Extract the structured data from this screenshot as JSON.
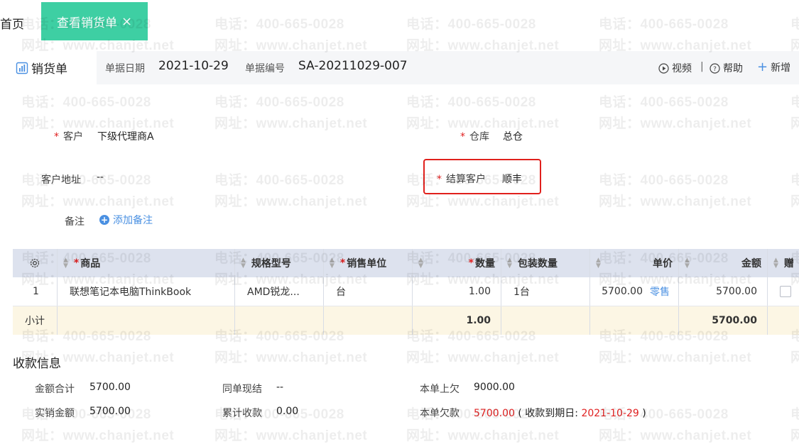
{
  "tabs": {
    "home": "首页",
    "active": "查看销货单",
    "close": "×"
  },
  "watermark": {
    "phone": "电话：400-665-0028",
    "site": "网址：www.chanjet.net"
  },
  "header": {
    "doc_type": "销货单",
    "date_label": "单据日期",
    "date_value": "2021-10-29",
    "number_label": "单据编号",
    "number_value": "SA-20211029-007",
    "video_label": "视频",
    "separator": "|",
    "help_label": "帮助",
    "add_label": "新增"
  },
  "form": {
    "required_mark": "*",
    "customer_label": "客户",
    "customer_value": "下级代理商A",
    "warehouse_label": "仓库",
    "warehouse_value": "总仓",
    "address_label": "客户地址",
    "address_value": "--",
    "settle_label": "结算客户",
    "settle_value": "顺丰",
    "note_label": "备注",
    "add_note": "添加备注"
  },
  "table": {
    "headers": {
      "product": "商品",
      "spec": "规格型号",
      "unit": "销售单位",
      "qty": "数量",
      "pack_qty": "包装数量",
      "price": "单价",
      "amount": "金额",
      "gift": "赠"
    },
    "rows": [
      {
        "index": "1",
        "product": "联想笔记本电脑ThinkBook",
        "spec": "AMD锐龙...",
        "unit": "台",
        "qty": "1.00",
        "pack_qty": "1台",
        "price": "5700.00",
        "price_type": "零售",
        "amount": "5700.00"
      }
    ],
    "subtotal": {
      "label": "小计",
      "qty": "1.00",
      "amount": "5700.00"
    }
  },
  "collection": {
    "title": "收款信息",
    "total_label": "金额合计",
    "total_value": "5700.00",
    "cash_label": "同单现结",
    "cash_value": "--",
    "prev_owe_label": "本单上欠",
    "prev_owe_value": "9000.00",
    "actual_label": "实销金额",
    "actual_value": "5700.00",
    "accum_label": "累计收款",
    "accum_value": "0.00",
    "owe_label": "本单欠款",
    "owe_value": "5700.00",
    "due_open": "( 收款到期日: ",
    "due_date": "2021-10-29",
    "due_close": " )"
  },
  "colors": {
    "accent": "#3ecfa3",
    "required": "#e02020",
    "link": "#4a90e2",
    "highlight_box": "#e0201c"
  }
}
